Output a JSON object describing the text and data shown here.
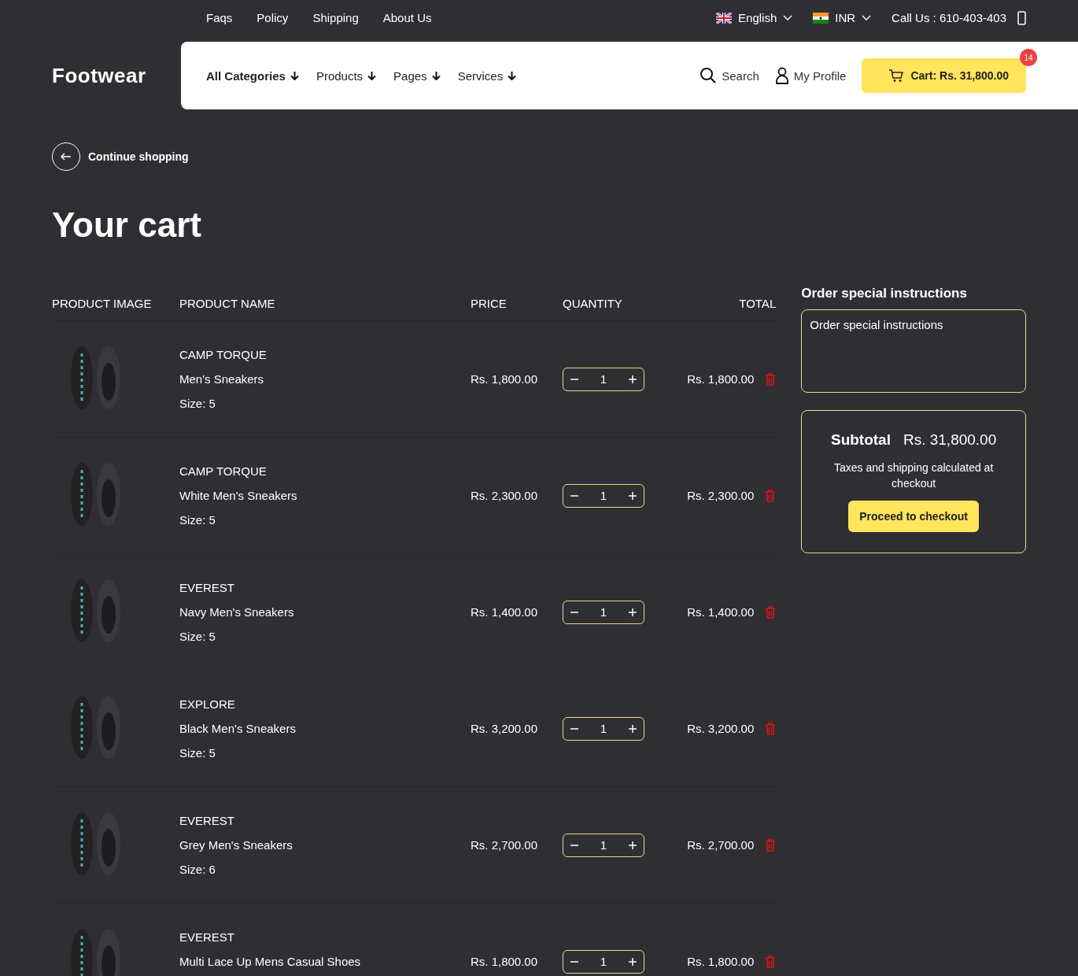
{
  "top_links": [
    "Faqs",
    "Policy",
    "Shipping",
    "About Us"
  ],
  "language": "English",
  "currency": "INR",
  "phone": "Call Us : 610-403-403",
  "logo": "Footwear",
  "nav": [
    {
      "label": "All Categories",
      "bold": true
    },
    {
      "label": "Products",
      "bold": false
    },
    {
      "label": "Pages",
      "bold": false
    },
    {
      "label": "Services",
      "bold": false
    }
  ],
  "search": "Search",
  "profile": "My Profile",
  "cart": {
    "label": "Cart: Rs. 31,800.00",
    "badge": "14"
  },
  "back": "Continue shopping",
  "title": "Your cart",
  "columns": [
    "PRODUCT IMAGE",
    "PRODUCT NAME",
    "PRICE",
    "QUANTITY",
    "TOTAL"
  ],
  "rows": [
    {
      "brand": "CAMP TORQUE",
      "name": "Men's Sneakers",
      "size": "Size: 5",
      "price": "Rs. 1,800.00",
      "qty": "1",
      "total": "Rs. 1,800.00"
    },
    {
      "brand": "CAMP TORQUE",
      "name": "White Men's Sneakers",
      "size": "Size: 5",
      "price": "Rs. 2,300.00",
      "qty": "1",
      "total": "Rs. 2,300.00"
    },
    {
      "brand": "EVEREST",
      "name": "Navy Men's Sneakers",
      "size": "Size: 5",
      "price": "Rs. 1,400.00",
      "qty": "1",
      "total": "Rs. 1,400.00"
    },
    {
      "brand": "EXPLORE",
      "name": "Black Men's Sneakers",
      "size": "Size: 5",
      "price": "Rs. 3,200.00",
      "qty": "1",
      "total": "Rs. 3,200.00"
    },
    {
      "brand": "EVEREST",
      "name": "Grey Men's Sneakers",
      "size": "Size: 6",
      "price": "Rs. 2,700.00",
      "qty": "1",
      "total": "Rs. 2,700.00"
    },
    {
      "brand": "EVEREST",
      "name": "Multi Lace Up Mens Casual Shoes",
      "price": "Rs. 1,800.00",
      "qty": "1",
      "total": "Rs. 1,800.00"
    }
  ],
  "instructions": {
    "title": "Order special instructions",
    "placeholder": "Order special instructions"
  },
  "summary": {
    "label": "Subtotal",
    "amount": "Rs. 31,800.00",
    "note": "Taxes and shipping calculated at checkout",
    "button": "Proceed to checkout"
  }
}
